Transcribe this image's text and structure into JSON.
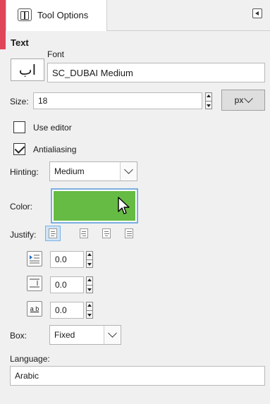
{
  "tab": {
    "label": "Tool Options"
  },
  "section": {
    "title": "Text"
  },
  "font": {
    "label": "Font",
    "preview_glyph": "اب",
    "value": "SC_DUBAI Medium"
  },
  "size": {
    "label": "Size:",
    "value": "18",
    "unit": "px"
  },
  "use_editor": {
    "label": "Use editor",
    "checked": false
  },
  "antialiasing": {
    "label": "Antialiasing",
    "checked": true
  },
  "hinting": {
    "label": "Hinting:",
    "value": "Medium"
  },
  "color": {
    "label": "Color:",
    "value": "#65bb43"
  },
  "justify": {
    "label": "Justify:",
    "options": [
      "left",
      "right",
      "center",
      "fill"
    ],
    "selected": "left"
  },
  "indent": {
    "value": "0.0"
  },
  "line_spacing": {
    "value": "0.0"
  },
  "letter_spacing": {
    "value": "0.0",
    "icon_text": "a b"
  },
  "box": {
    "label": "Box:",
    "value": "Fixed"
  },
  "language": {
    "label": "Language:",
    "value": "Arabic"
  }
}
